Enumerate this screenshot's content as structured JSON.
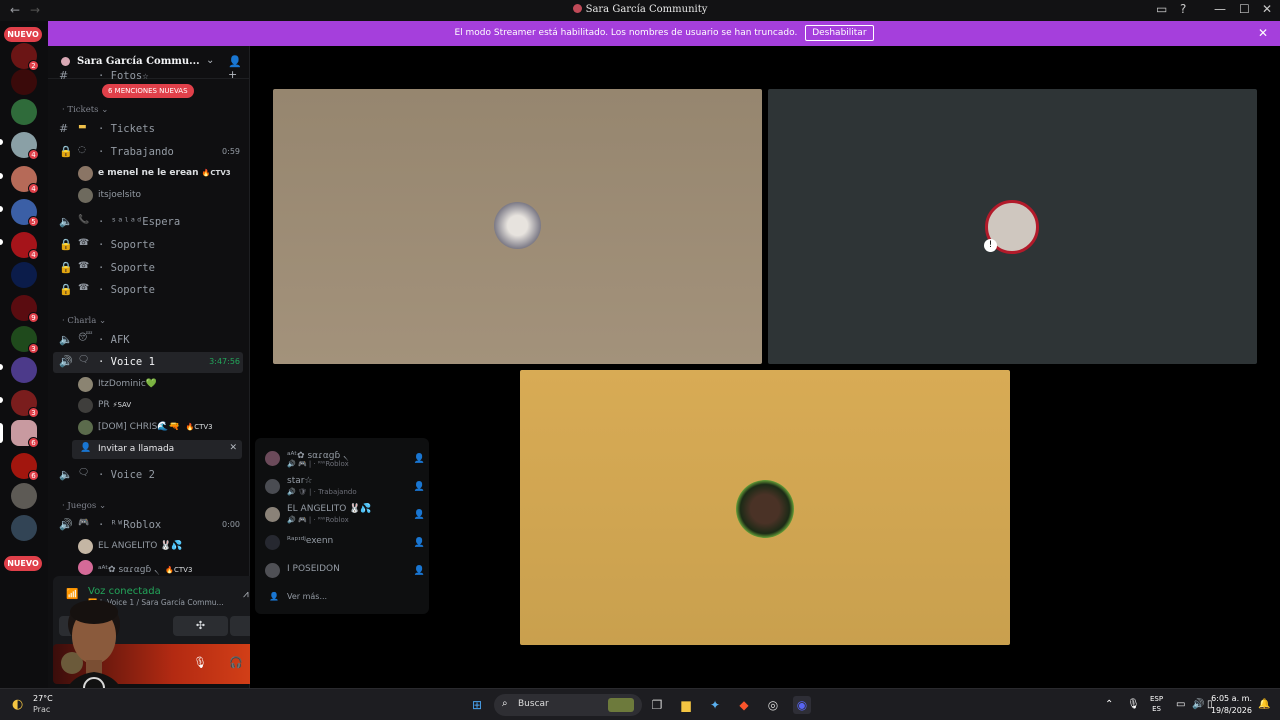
{
  "window": {
    "title": "Sara García Community",
    "back_icon": "←",
    "forward_icon": "→",
    "controls": [
      "▭",
      "?",
      "—",
      "☐",
      "✕"
    ]
  },
  "banner": {
    "text": "El modo Streamer está habilitado. Los nombres de usuario se han truncado.",
    "button": "Deshabilitar",
    "close": "✕"
  },
  "servers": {
    "nuevo_top": "NUEVO",
    "nuevo_bottom": "NUEVO",
    "badges": [
      "2",
      "4",
      "4",
      "5",
      "4",
      "9",
      "3",
      "3",
      "6",
      "6"
    ]
  },
  "guild": {
    "name": "Sara García Commu...",
    "chevron": "⌄",
    "invite_icon": "👤+"
  },
  "channels": {
    "top_partial": "· Fotos☆",
    "mentions": "6 MENCIONES NUEVAS",
    "cat_tickets": "· Tickets ⌄",
    "tickets": "· Tickets",
    "trabajando": "· Trabajando",
    "trabajando_time": "0:59",
    "users_trabajando": [
      {
        "name": "e menel ne le erean",
        "tag": "🔥CTV3"
      },
      {
        "name": "itsjoelsito",
        "tag": ""
      }
    ],
    "espera": "· ˢᵃˡᵃᵈEspera",
    "soporte1": "· Soporte",
    "soporte2": "· Soporte",
    "soporte3": "· Soporte",
    "cat_charla": "· Charla ⌄",
    "afk": "· AFK",
    "voice1": "· Voice 1",
    "voice1_time": "3:47:56",
    "users_voice1": [
      {
        "name": "ItzDominic💚",
        "tag": ""
      },
      {
        "name": "PR",
        "tag": "⚡SAV"
      },
      {
        "name": "[DOM] CHRIS🌊🔫",
        "tag": "🔥CTV3"
      }
    ],
    "invite": "Invitar a llamada",
    "voice2": "· Voice 2",
    "cat_juegos": "· Juegos ⌄",
    "roblox": "· ᴿᵂRoblox",
    "roblox_time": "0:00",
    "users_roblox": [
      {
        "name": "EL ANGELITO 🐰💦",
        "tag": ""
      },
      {
        "name": "ᵃᴬᵗ✿ sαɾαgɓ ৲",
        "tag": "🔥CTV3"
      }
    ]
  },
  "voice_panel": {
    "status": "Voz conectada",
    "sub": "📶 | ·Voice 1 / Sara García Commu...",
    "noise_icon": "⩘",
    "hangup_icon": "☎",
    "buttons": [
      "camera-off",
      "activities",
      "soundboard"
    ]
  },
  "user_bar": {
    "mic_icon": "🎙",
    "headset_icon": "🎧",
    "gear_icon": "⚙"
  },
  "popup": {
    "items": [
      {
        "name": "ᵃᴬᵗ✿ sαɾαgɓ ৲",
        "sub": "🔊 🎮 | · ᴿᵂRoblox"
      },
      {
        "name": "star☆",
        "sub": "🔊 🛡 | · Trabajando"
      },
      {
        "name": "EL ANGELITO 🐰💦",
        "sub": "🔊 🎮 | · ᴿᵂRoblox"
      },
      {
        "name": "ᴿᵃᵖᶦᵈʲexenn",
        "sub": ""
      },
      {
        "name": "I POSEIDON",
        "sub": ""
      }
    ],
    "more": "Ver más..."
  },
  "taskbar": {
    "weather_temp": "27°C",
    "weather_sub": "Prac",
    "search": "Buscar",
    "lang1": "ESP",
    "lang2": "ES",
    "time": "6:05 a. m.",
    "date": "19/8/2026"
  },
  "colors": {
    "banner": "#a53fdc",
    "online": "#23a55a",
    "danger": "#e0404a",
    "tile1": "#9c8c76",
    "tile2": "#2e3436",
    "tile3": "#d4a852"
  }
}
